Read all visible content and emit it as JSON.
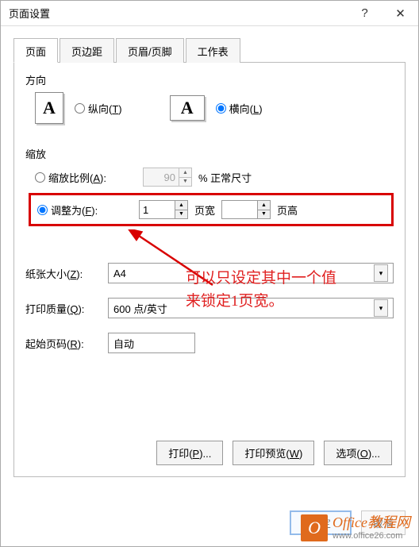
{
  "title": "页面设置",
  "titlebar": {
    "help": "?",
    "close": "✕"
  },
  "tabs": {
    "page": "页面",
    "margins": "页边距",
    "headerfooter": "页眉/页脚",
    "sheet": "工作表"
  },
  "orientation": {
    "label": "方向",
    "portrait": "纵向(T)",
    "landscape": "横向(L)",
    "iconA": "A"
  },
  "scale": {
    "label": "缩放",
    "adjust_to": "缩放比例(A):",
    "adjust_val": "90",
    "adjust_suffix": "% 正常尺寸",
    "fit_to": "调整为(F):",
    "fit_wide_val": "1",
    "fit_wide_lbl": "页宽",
    "fit_tall_val": "",
    "fit_tall_lbl": "页高"
  },
  "paper": {
    "label": "纸张大小(Z):",
    "value": "A4"
  },
  "quality": {
    "label": "打印质量(Q):",
    "value": "600 点/英寸"
  },
  "firstpage": {
    "label": "起始页码(R):",
    "value": "自动"
  },
  "annotation": {
    "line1": "可以只设定其中一个值",
    "line2": "来锁定1页宽。"
  },
  "buttons": {
    "print": "打印(P)...",
    "preview": "打印预览(W)",
    "options": "选项(O)...",
    "ok": "确定",
    "cancel": "取消"
  },
  "watermark": {
    "icon": "O",
    "brand": "Office教程网",
    "url": "www.office26.com"
  }
}
